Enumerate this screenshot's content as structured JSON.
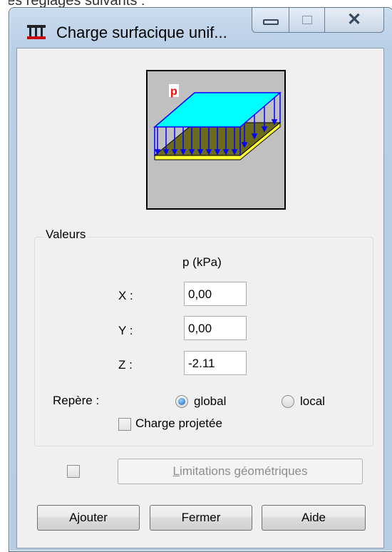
{
  "background": {
    "top_text": "ces réglages suivants :"
  },
  "window": {
    "title": "Charge surfacique unif...",
    "controls": {
      "minimize": "minimize-icon",
      "maximize": "maximize-icon",
      "close": "close-icon"
    }
  },
  "illustration": {
    "load_label": "p"
  },
  "values_group": {
    "title": "Valeurs",
    "column_header": "p  (kPa)",
    "rows": [
      {
        "label": "X :",
        "value": "0,00"
      },
      {
        "label": "Y :",
        "value": "0,00"
      },
      {
        "label": "Z :",
        "value": "-2.11"
      }
    ],
    "frame": {
      "label": "Repère :",
      "options": [
        {
          "label": "global",
          "checked": true
        },
        {
          "label": "local",
          "checked": false
        }
      ]
    },
    "projected_load": {
      "label": "Charge projetée",
      "checked": false
    }
  },
  "limits": {
    "checked": false,
    "button_label_prefix": "L",
    "button_label_rest": "imitations géométriques"
  },
  "buttons": {
    "add": "Ajouter",
    "close": "Fermer",
    "help": "Aide"
  },
  "colors": {
    "top_face": "#00ffff",
    "slab": "#6b6b1a",
    "slab_edge": "#ffff33",
    "arrows": "#0000ff",
    "label_red": "#ff0000"
  }
}
